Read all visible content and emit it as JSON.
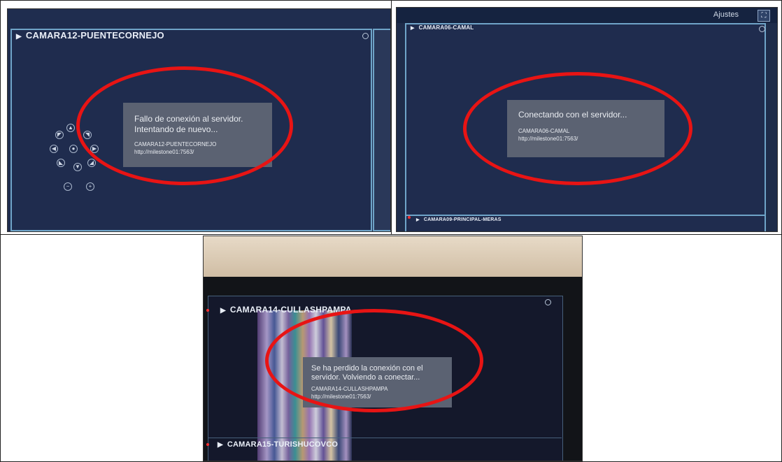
{
  "panels": [
    {
      "camera_title": "CAMARA12-PUENTECORNEJO",
      "message": {
        "line1": "Fallo de conexión al servidor.",
        "line2": "Intentando de nuevo...",
        "camera": "CAMARA12-PUENTECORNEJO",
        "url": "http://milestone01:7563/"
      }
    },
    {
      "top_bar": {
        "settings_label": "Ajustes",
        "fullscreen_icon": "fullscreen-icon"
      },
      "camera_title": "CAMARA06-CAMAL",
      "message": {
        "line1": "Conectando con el servidor...",
        "camera": "CAMARA06-CAMAL",
        "url": "http://milestone01:7563/"
      },
      "bottom_camera_title": "CAMARA09-PRINCIPAL-MERAS"
    },
    {
      "camera_title": "CAMARA14-CULLASHPAMPA",
      "message": {
        "line1": "Se ha perdido la conexión con el",
        "line2": "servidor. Volviendo a conectar...",
        "camera": "CAMARA14-CULLASHPAMPA",
        "url": "http://milestone01:7563/"
      },
      "bottom_camera_title": "CAMARA15-TURISHUCOVCO"
    }
  ],
  "highlight_color": "#e81414"
}
